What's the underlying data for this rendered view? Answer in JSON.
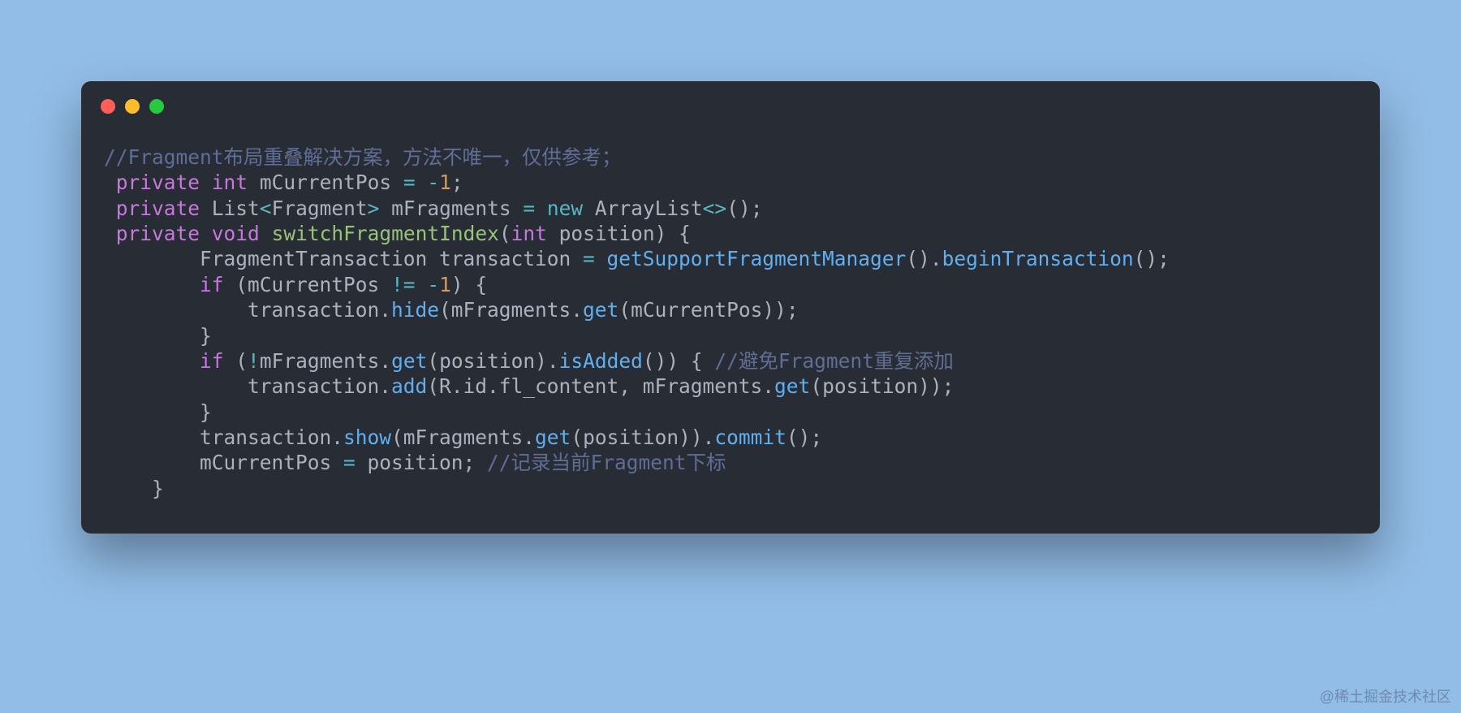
{
  "watermark": "@稀土掘金技术社区",
  "traffic_light_names": [
    "close-icon",
    "minimize-icon",
    "maximize-icon"
  ],
  "code": {
    "language": "java",
    "tokens": [
      [
        {
          "t": "comment",
          "v": "//Fragment布局重叠解决方案，方法不唯一，仅供参考；"
        }
      ],
      [
        {
          "t": "plain",
          "v": " "
        },
        {
          "t": "keyword",
          "v": "private"
        },
        {
          "t": "plain",
          "v": " "
        },
        {
          "t": "type",
          "v": "int"
        },
        {
          "t": "plain",
          "v": " mCurrentPos "
        },
        {
          "t": "op",
          "v": "="
        },
        {
          "t": "plain",
          "v": " "
        },
        {
          "t": "op",
          "v": "-"
        },
        {
          "t": "num",
          "v": "1"
        },
        {
          "t": "plain",
          "v": ";"
        }
      ],
      [
        {
          "t": "plain",
          "v": " "
        },
        {
          "t": "keyword",
          "v": "private"
        },
        {
          "t": "plain",
          "v": " List"
        },
        {
          "t": "op",
          "v": "<"
        },
        {
          "t": "plain",
          "v": "Fragment"
        },
        {
          "t": "op",
          "v": ">"
        },
        {
          "t": "plain",
          "v": " mFragments "
        },
        {
          "t": "op",
          "v": "="
        },
        {
          "t": "plain",
          "v": " "
        },
        {
          "t": "new",
          "v": "new"
        },
        {
          "t": "plain",
          "v": " ArrayList"
        },
        {
          "t": "op",
          "v": "<>"
        },
        {
          "t": "plain",
          "v": "();"
        }
      ],
      [
        {
          "t": "plain",
          "v": " "
        },
        {
          "t": "keyword",
          "v": "private"
        },
        {
          "t": "plain",
          "v": " "
        },
        {
          "t": "type",
          "v": "void"
        },
        {
          "t": "plain",
          "v": " "
        },
        {
          "t": "funcdef",
          "v": "switchFragmentIndex"
        },
        {
          "t": "plain",
          "v": "("
        },
        {
          "t": "type",
          "v": "int"
        },
        {
          "t": "plain",
          "v": " position) {"
        }
      ],
      [
        {
          "t": "plain",
          "v": "        FragmentTransaction transaction "
        },
        {
          "t": "op",
          "v": "="
        },
        {
          "t": "plain",
          "v": " "
        },
        {
          "t": "func",
          "v": "getSupportFragmentManager"
        },
        {
          "t": "plain",
          "v": "()."
        },
        {
          "t": "func",
          "v": "beginTransaction"
        },
        {
          "t": "plain",
          "v": "();"
        }
      ],
      [
        {
          "t": "plain",
          "v": "        "
        },
        {
          "t": "keyword",
          "v": "if"
        },
        {
          "t": "plain",
          "v": " (mCurrentPos "
        },
        {
          "t": "op",
          "v": "!="
        },
        {
          "t": "plain",
          "v": " "
        },
        {
          "t": "op",
          "v": "-"
        },
        {
          "t": "num",
          "v": "1"
        },
        {
          "t": "plain",
          "v": ") {"
        }
      ],
      [
        {
          "t": "plain",
          "v": "            transaction."
        },
        {
          "t": "func",
          "v": "hide"
        },
        {
          "t": "plain",
          "v": "(mFragments."
        },
        {
          "t": "func",
          "v": "get"
        },
        {
          "t": "plain",
          "v": "(mCurrentPos));"
        }
      ],
      [
        {
          "t": "plain",
          "v": "        }"
        }
      ],
      [
        {
          "t": "plain",
          "v": "        "
        },
        {
          "t": "keyword",
          "v": "if"
        },
        {
          "t": "plain",
          "v": " ("
        },
        {
          "t": "op",
          "v": "!"
        },
        {
          "t": "plain",
          "v": "mFragments."
        },
        {
          "t": "func",
          "v": "get"
        },
        {
          "t": "plain",
          "v": "(position)."
        },
        {
          "t": "func",
          "v": "isAdded"
        },
        {
          "t": "plain",
          "v": "()) { "
        },
        {
          "t": "comment",
          "v": "//避免Fragment重复添加"
        }
      ],
      [
        {
          "t": "plain",
          "v": "            transaction."
        },
        {
          "t": "func",
          "v": "add"
        },
        {
          "t": "plain",
          "v": "(R.id.fl_content, mFragments."
        },
        {
          "t": "func",
          "v": "get"
        },
        {
          "t": "plain",
          "v": "(position));"
        }
      ],
      [
        {
          "t": "plain",
          "v": "        }"
        }
      ],
      [
        {
          "t": "plain",
          "v": "        transaction."
        },
        {
          "t": "func",
          "v": "show"
        },
        {
          "t": "plain",
          "v": "(mFragments."
        },
        {
          "t": "func",
          "v": "get"
        },
        {
          "t": "plain",
          "v": "(position))."
        },
        {
          "t": "func",
          "v": "commit"
        },
        {
          "t": "plain",
          "v": "();"
        }
      ],
      [
        {
          "t": "plain",
          "v": "        mCurrentPos "
        },
        {
          "t": "op",
          "v": "="
        },
        {
          "t": "plain",
          "v": " position; "
        },
        {
          "t": "comment",
          "v": "//记录当前Fragment下标"
        }
      ],
      [
        {
          "t": "plain",
          "v": "    }"
        }
      ]
    ]
  }
}
